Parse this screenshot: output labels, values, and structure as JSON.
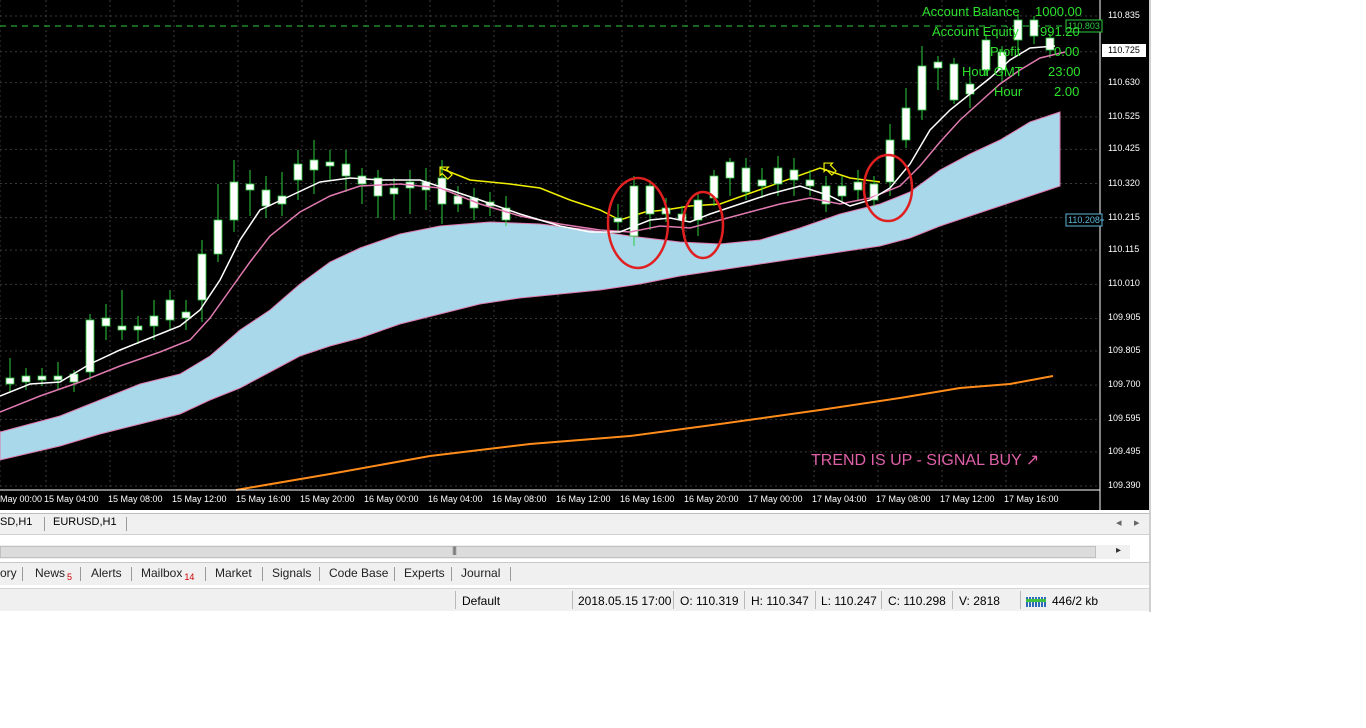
{
  "account": {
    "balance_label": "Account Balance",
    "balance_value": "1000.00",
    "equity_label": "Account Equity",
    "equity_value": "991.20",
    "profit_label": "Profit",
    "profit_value": "0.00",
    "hour_gmt_label": "Hour GMT",
    "hour_gmt_value": "23:00",
    "hour_label": "Hour",
    "hour_value": "2.00"
  },
  "price_axis": [
    "110.835",
    "110.725",
    "110.630",
    "110.525",
    "110.425",
    "110.320",
    "110.215",
    "110.115",
    "110.010",
    "109.905",
    "109.805",
    "109.700",
    "109.595",
    "109.495",
    "109.390"
  ],
  "price_markers": {
    "top_partial": "110.803",
    "band": "110.208"
  },
  "time_axis": [
    "May 00:00",
    "15 May 04:00",
    "15 May 08:00",
    "15 May 12:00",
    "15 May 16:00",
    "15 May 20:00",
    "16 May 00:00",
    "16 May 04:00",
    "16 May 08:00",
    "16 May 12:00",
    "16 May 16:00",
    "16 May 20:00",
    "17 May 00:00",
    "17 May 04:00",
    "17 May 08:00",
    "17 May 12:00",
    "17 May 16:00"
  ],
  "signal_text": "TREND IS UP - SIGNAL BUY ↗",
  "chart_tabs": [
    "SD,H1",
    "EURUSD,H1"
  ],
  "terminal_tabs": [
    {
      "label": "ory",
      "badge": ""
    },
    {
      "label": "News",
      "badge": "5"
    },
    {
      "label": "Alerts",
      "badge": ""
    },
    {
      "label": "Mailbox",
      "badge": "14"
    },
    {
      "label": "Market",
      "badge": ""
    },
    {
      "label": "Signals",
      "badge": ""
    },
    {
      "label": "Code Base",
      "badge": ""
    },
    {
      "label": "Experts",
      "badge": ""
    },
    {
      "label": "Journal",
      "badge": ""
    }
  ],
  "status": {
    "profile": "Default",
    "datetime": "2018.05.15 17:00",
    "open": "O: 110.319",
    "high": "H: 110.347",
    "low": "L: 110.247",
    "close": "C: 110.298",
    "volume": "V: 2818",
    "traffic": "446/2 kb"
  },
  "colors": {
    "background": "#000000",
    "bull_candle": "#ffffff",
    "wick": "#2ecc40",
    "cloud": "#a8d8ea",
    "fast_ma": "#ffffff",
    "slow_ma": "#e07ab0",
    "yellow_line": "#f0f000",
    "long_ma": "#ff8c1a",
    "signal_circle": "#e02020",
    "signal_text": "#e060a8",
    "info_text": "#2ee02e"
  }
}
